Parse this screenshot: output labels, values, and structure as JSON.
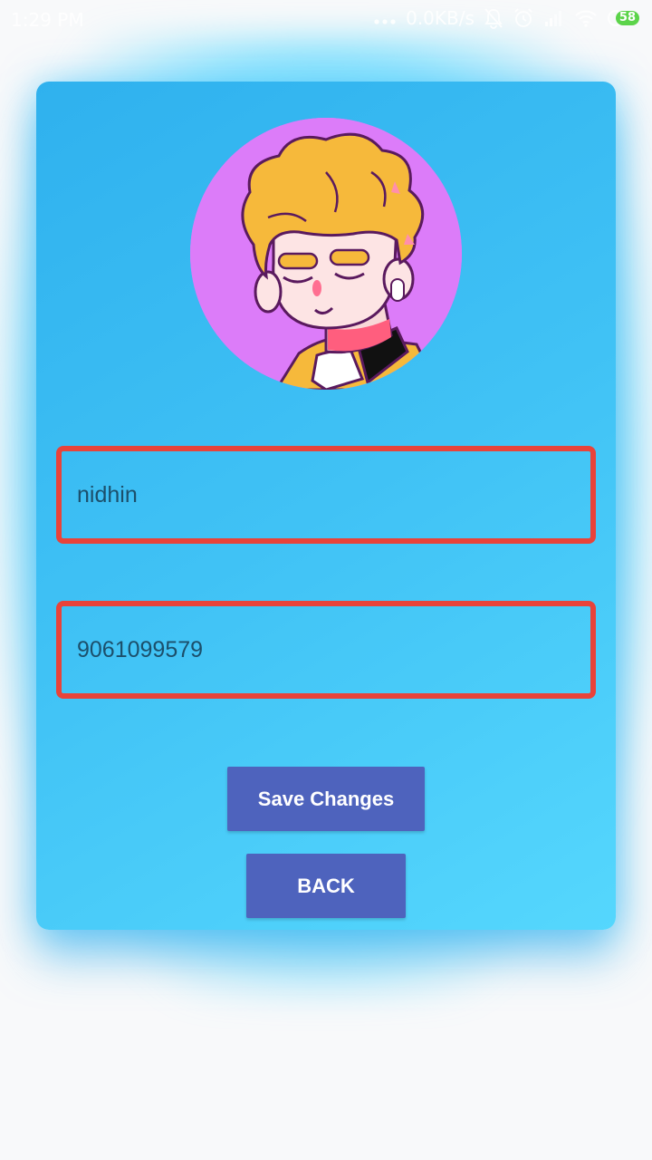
{
  "status_bar": {
    "time": "1:29 PM",
    "network_speed": "0.0KB/s",
    "battery_level": "58",
    "icons": [
      "dots-icon",
      "bell-off-icon",
      "alarm-icon",
      "signal-icon",
      "wifi-icon",
      "battery-icon"
    ]
  },
  "profile": {
    "avatar_icon": "avatar-illustration",
    "name_value": "nidhin",
    "phone_value": "9061099579"
  },
  "actions": {
    "save_label": "Save Changes",
    "back_label": "BACK"
  },
  "colors": {
    "card_gradient_start": "#2fb1ee",
    "card_gradient_end": "#55d7fd",
    "input_border": "#e8433a",
    "button_bg": "#4e63bd",
    "avatar_bg": "#dc7cf9"
  }
}
